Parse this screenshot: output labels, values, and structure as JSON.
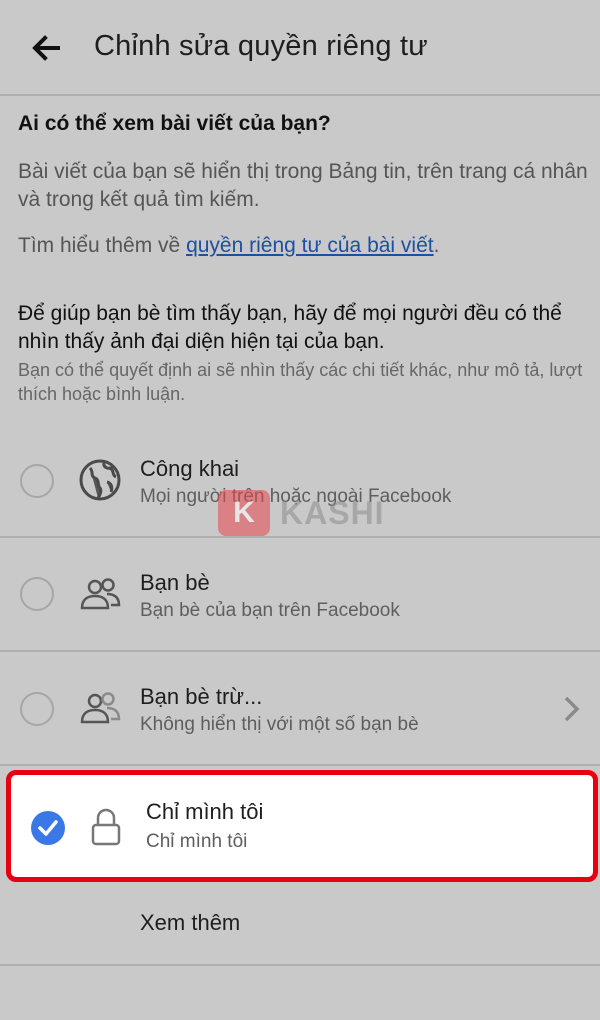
{
  "header": {
    "title": "Chỉnh sửa quyền riêng tư"
  },
  "intro": {
    "question": "Ai có thể xem bài viết của bạn?",
    "description": "Bài viết của bạn sẽ hiển thị trong Bảng tin, trên trang cá nhân và trong kết quả tìm kiếm.",
    "learn_prefix": "Tìm hiểu thêm về ",
    "learn_link": "quyền riêng tư của bài viết",
    "learn_suffix": ".",
    "help_title": "Để giúp bạn bè tìm thấy bạn, hãy để mọi người đều có thể nhìn thấy ảnh đại diện hiện tại của bạn.",
    "help_sub": "Bạn có thể quyết định ai sẽ nhìn thấy các chi tiết khác, như mô tả, lượt thích hoặc bình luận."
  },
  "options": [
    {
      "title": "Công khai",
      "subtitle": "Mọi người trên hoặc ngoài Facebook",
      "icon": "globe-icon",
      "selected": false
    },
    {
      "title": "Bạn bè",
      "subtitle": "Bạn bè của bạn trên Facebook",
      "icon": "friends-icon",
      "selected": false
    },
    {
      "title": "Bạn bè trừ...",
      "subtitle": "Không hiển thị với một số bạn bè",
      "icon": "friends-except-icon",
      "selected": false
    },
    {
      "title": "Chỉ mình tôi",
      "subtitle": "Chỉ mình tôi",
      "icon": "lock-icon",
      "selected": true
    }
  ],
  "see_more": "Xem thêm",
  "watermark": {
    "badge": "K",
    "text": "KASHI"
  },
  "colors": {
    "background": "#c9c9c9",
    "link": "#1d4fa3",
    "highlight": "#e60012",
    "check": "#3b78e7"
  }
}
